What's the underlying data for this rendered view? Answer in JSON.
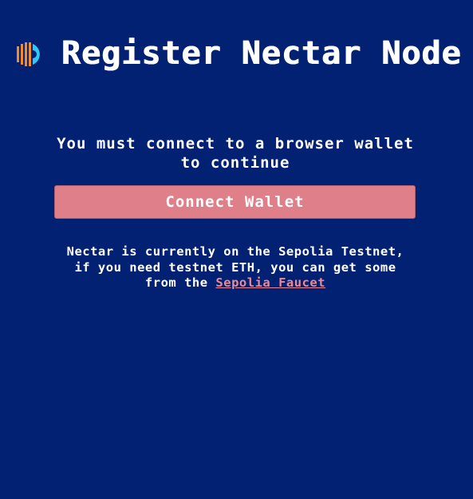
{
  "header": {
    "logo_icon": "nectar-logo-icon",
    "title": "Register Nectar Node"
  },
  "connect": {
    "message": "You must connect to a browser wallet to continue",
    "button_label": "Connect Wallet"
  },
  "notice": {
    "text_before_link": "Nectar is currently on the Sepolia Testnet, if you need testnet ETH, you can get some from the ",
    "link_label": "Sepolia Faucet"
  },
  "colors": {
    "background": "#022172",
    "button": "#df7f89",
    "link": "#e98a96",
    "logo_orange": "#f08a2c",
    "logo_cyan": "#31c7f0"
  }
}
